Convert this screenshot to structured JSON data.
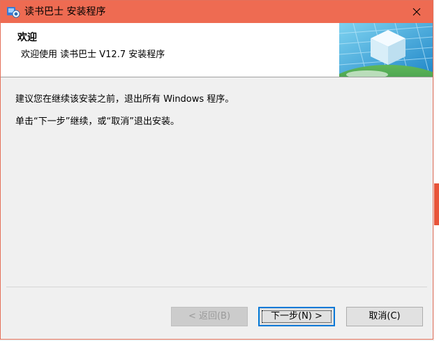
{
  "window": {
    "title": "读书巴士 安装程序",
    "icons": {
      "app": "installer-icon",
      "close": "close-icon"
    }
  },
  "banner": {
    "title": "欢迎",
    "subtitle": "欢迎使用 读书巴士 V12.7 安装程序",
    "image": "installer-cube-graphic"
  },
  "content": {
    "line1": "建议您在继续该安装之前，退出所有 Windows 程序。",
    "line2": "单击“下一步”继续，或“取消”退出安装。"
  },
  "buttons": {
    "back": "< 返回(B)",
    "next": "下一步(N) >",
    "cancel": "取消(C)"
  },
  "colors": {
    "titlebar": "#ee6b52",
    "next_border": "#0078d7"
  }
}
